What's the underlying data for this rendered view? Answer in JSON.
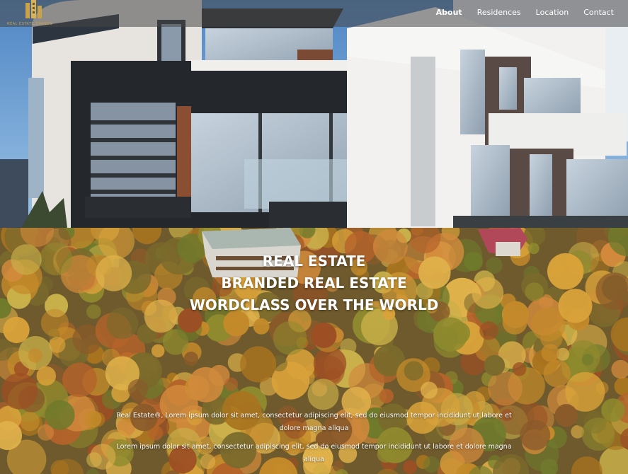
{
  "brand": {
    "name": "REAL ESTATE BRANDS",
    "logo_icon": "building-logo-icon",
    "gold": "#c9a24a"
  },
  "nav": {
    "items": [
      {
        "label": "About",
        "active": true
      },
      {
        "label": "Residences",
        "active": false
      },
      {
        "label": "Location",
        "active": false
      },
      {
        "label": "Contact",
        "active": false
      }
    ]
  },
  "hero": {
    "headline": [
      "REAL ESTATE",
      "BRANDED REAL ESTATE",
      "WORDCLASS OVER THE WORLD"
    ]
  },
  "body": {
    "paragraph1": "Real Estate®, Lorem ipsum dolor sit amet, consectetur adipiscing elit, sed do eiusmod tempor incididunt ut labore et dolore magna aliqua",
    "paragraph2": "Lorem ipsum dolor sit amet, consectetur adipiscing elit, sed do eiusmod tempor incididunt ut labore et dolore magna aliqua"
  }
}
